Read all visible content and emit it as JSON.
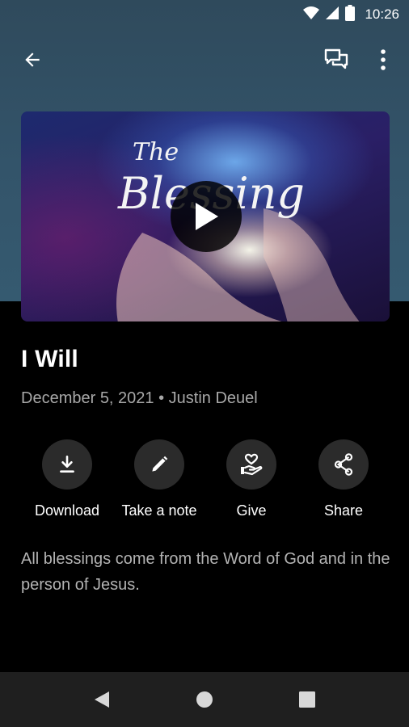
{
  "status_bar": {
    "time": "10:26",
    "icons": [
      "wifi-icon",
      "cell-signal-icon",
      "battery-icon"
    ]
  },
  "app_bar": {
    "back_icon": "arrow-left-icon",
    "chat_icon": "chat-bubbles-icon",
    "more_icon": "more-vertical-icon"
  },
  "media": {
    "thumbnail_text": [
      "The",
      "Blessing"
    ],
    "play_icon": "play-icon"
  },
  "sermon": {
    "title": "I Will",
    "meta": "December 5, 2021 • Justin Deuel",
    "description": "All blessings come from the Word of God and in the person of Jesus."
  },
  "actions": [
    {
      "label": "Download",
      "icon": "download-icon"
    },
    {
      "label": "Take a note",
      "icon": "pencil-icon"
    },
    {
      "label": "Give",
      "icon": "give-heart-hand-icon"
    },
    {
      "label": "Share",
      "icon": "share-icon"
    }
  ],
  "nav_bar": {
    "icons": [
      "nav-back-icon",
      "nav-home-icon",
      "nav-recents-icon"
    ]
  },
  "colors": {
    "header_bg": "#33546a",
    "background": "#000000",
    "action_circle": "#2b2b2b",
    "nav_bar": "#1f1f1f"
  }
}
